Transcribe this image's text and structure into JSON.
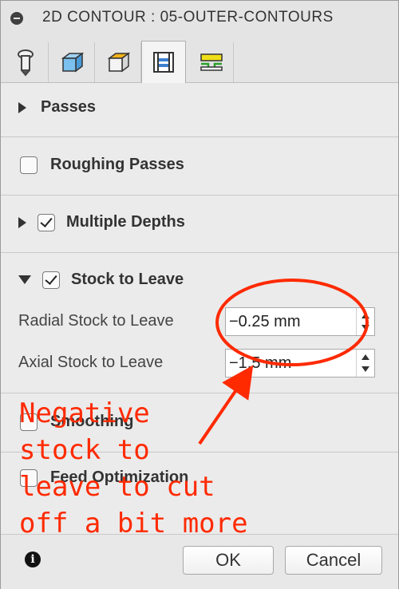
{
  "dialog": {
    "title": "2D CONTOUR : 05-OUTER-CONTOURS"
  },
  "tabs": [
    {
      "icon": "tool-icon"
    },
    {
      "icon": "geometry-icon"
    },
    {
      "icon": "heights-icon"
    },
    {
      "icon": "passes-icon",
      "active": true
    },
    {
      "icon": "linking-icon"
    }
  ],
  "sections": {
    "passes": {
      "label": "Passes"
    },
    "roughing": {
      "label": "Roughing Passes",
      "checked": false
    },
    "multiple_depths": {
      "label": "Multiple Depths",
      "checked": true
    },
    "stock_to_leave": {
      "label": "Stock to Leave",
      "checked": true,
      "radial": {
        "label": "Radial Stock to Leave",
        "value": "−0.25 mm"
      },
      "axial": {
        "label": "Axial Stock to Leave",
        "value": "−1.5 mm"
      }
    },
    "smoothing": {
      "label": "Smoothing",
      "checked": false
    },
    "feed_optimization": {
      "label": "Feed Optimization",
      "checked": false
    }
  },
  "footer": {
    "ok": "OK",
    "cancel": "Cancel"
  },
  "annotation": {
    "text": "Negative\nstock to\nleave to cut\noff a bit more",
    "color": "#ff2a00"
  }
}
